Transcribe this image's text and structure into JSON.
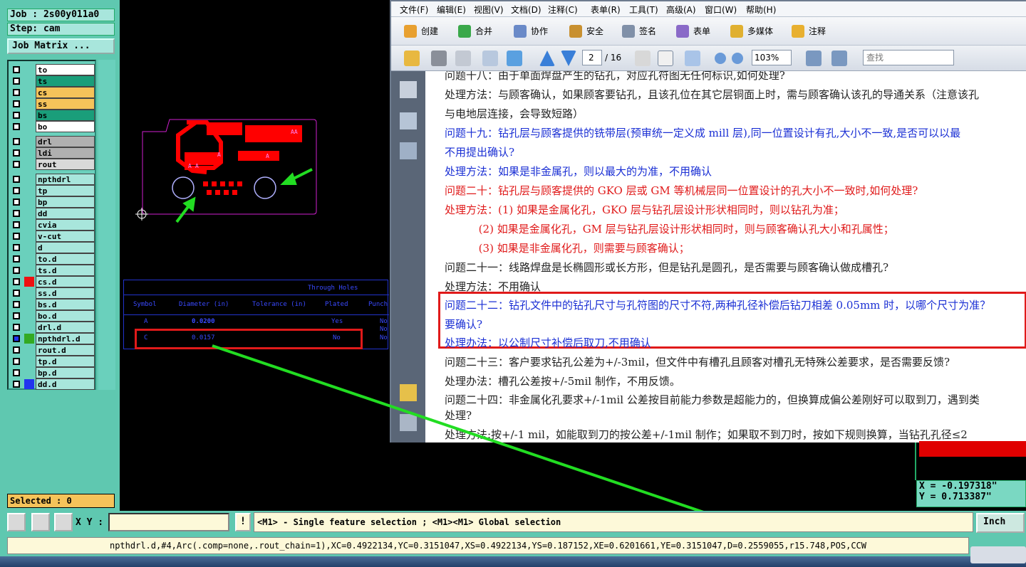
{
  "cam": {
    "job": "Job : 2s00y011a0",
    "step": "Step: cam",
    "job_matrix": "Job Matrix ...",
    "selected": "Selected : 0",
    "layers": [
      {
        "name": "to",
        "color": "#ffffff"
      },
      {
        "name": "ts",
        "color": "#1a9e7a"
      },
      {
        "name": "cs",
        "color": "#f5c35a"
      },
      {
        "name": "ss",
        "color": "#f5c35a"
      },
      {
        "name": "bs",
        "color": "#1a9e7a"
      },
      {
        "name": "bo",
        "color": "#ffffff"
      },
      {
        "name": "drl",
        "color": "#b0b0b0"
      },
      {
        "name": "ldi",
        "color": "#b0b0b0"
      },
      {
        "name": "rout",
        "color": "#d9d9d9"
      },
      {
        "name": "npthdrl",
        "color": "#a8e6dc"
      },
      {
        "name": "tp",
        "color": "#a8e6dc"
      },
      {
        "name": "bp",
        "color": "#a8e6dc"
      },
      {
        "name": "dd",
        "color": "#a8e6dc"
      },
      {
        "name": "cvia",
        "color": "#a8e6dc"
      },
      {
        "name": "v-cut",
        "color": "#a8e6dc"
      },
      {
        "name": "d",
        "color": "#a8e6dc"
      },
      {
        "name": "to.d",
        "color": "#a8e6dc"
      },
      {
        "name": "ts.d",
        "color": "#a8e6dc"
      },
      {
        "name": "cs.d",
        "color": "#a8e6dc",
        "swatch": "#ee1111"
      },
      {
        "name": "ss.d",
        "color": "#a8e6dc"
      },
      {
        "name": "bs.d",
        "color": "#a8e6dc"
      },
      {
        "name": "bo.d",
        "color": "#a8e6dc"
      },
      {
        "name": "drl.d",
        "color": "#a8e6dc"
      },
      {
        "name": "npthdrl.d",
        "color": "#a8e6dc",
        "swatch": "#33aa22",
        "checked": true
      },
      {
        "name": "rout.d",
        "color": "#a8e6dc"
      },
      {
        "name": "tp.d",
        "color": "#a8e6dc"
      },
      {
        "name": "bp.d",
        "color": "#a8e6dc"
      },
      {
        "name": "dd.d",
        "color": "#a8e6dc",
        "swatch": "#2233ee"
      }
    ],
    "pad_labels": [
      "AA",
      "A",
      "A",
      "A",
      "A"
    ],
    "holes_table": {
      "title": "Through Holes",
      "headers": [
        "Symbol",
        "Diameter (in)",
        "Tolerance (in)",
        "Plated",
        "Punch"
      ],
      "rows": [
        {
          "symbol": "A",
          "diameter": "0.0200",
          "plated": "Yes",
          "punch": "No"
        },
        {
          "symbol": "C",
          "diameter": "0.0157",
          "plated": "No",
          "punch": "No"
        }
      ],
      "punch_extra": "No"
    },
    "coords": {
      "x": "X = -0.197318\"",
      "y": "Y =  0.713387\""
    },
    "xy_label": "X Y :",
    "excl": "!",
    "prompt": "<M1> - Single feature selection ; <M1><M1> Global selection",
    "unit": "Inch",
    "feature": "npthdrl.d,#4,Arc(.comp=none,.rout_chain=1),XC=0.4922134,YC=0.3151047,XS=0.4922134,YS=0.187152,XE=0.6201661,YE=0.3151047,D=0.2559055,r15.748,POS,CCW"
  },
  "acrobat": {
    "menu": [
      "文件(F)",
      "编辑(E)",
      "视图(V)",
      "文档(D)",
      "注释(C)",
      "表单(R)",
      "工具(T)",
      "高级(A)",
      "窗口(W)",
      "帮助(H)"
    ],
    "toolbar": [
      {
        "label": "创建",
        "icon": "create-icon"
      },
      {
        "label": "合并",
        "icon": "merge-icon"
      },
      {
        "label": "协作",
        "icon": "collaborate-icon"
      },
      {
        "label": "安全",
        "icon": "lock-icon"
      },
      {
        "label": "签名",
        "icon": "pen-icon"
      },
      {
        "label": "表单",
        "icon": "form-icon"
      },
      {
        "label": "多媒体",
        "icon": "multimedia-icon"
      },
      {
        "label": "注释",
        "icon": "comment-icon"
      }
    ],
    "page_current": "2",
    "page_total": "/ 16",
    "zoom": "103%",
    "find_placeholder": "查找",
    "lines": [
      {
        "text": "问题十八：由于单面焊盘产生的钻孔，对应孔符图无任何标识,如何处理?",
        "color": "black"
      },
      {
        "text": "处理方法：与顾客确认，如果顾客要钻孔，且该孔位在其它层铜面上时，需与顾客确认该孔的导通关系（注意该孔",
        "color": "black"
      },
      {
        "text": "与电地层连接，会导致短路）",
        "color": "black"
      },
      {
        "text": "问题十九：钻孔层与顾客提供的铣带层(预审统一定义成 mill 层),同一位置设计有孔,大小不一致,是否可以以最",
        "color": "blue"
      },
      {
        "text": "不用提出确认?",
        "color": "blue"
      },
      {
        "text": "处理方法：如果是非金属孔，则以最大的为准，不用确认",
        "color": "blue"
      },
      {
        "text": "问题二十：钻孔层与顾客提供的 GKO 层或 GM 等机械层同一位置设计的孔大小不一致时,如何处理?",
        "color": "red"
      },
      {
        "text": "处理方法：(1) 如果是金属化孔，GKO 层与钻孔层设计形状相同时，则以钻孔为准；",
        "color": "red"
      },
      {
        "text": "          (2) 如果是金属化孔，GM 层与钻孔层设计形状相同时，则与顾客确认孔大小和孔属性；",
        "color": "red"
      },
      {
        "text": "          (3) 如果是非金属化孔，则需要与顾客确认；",
        "color": "red"
      },
      {
        "text": "问题二十一：线路焊盘是长椭圆形或长方形，但是钻孔是圆孔，是否需要与顾客确认做成槽孔?",
        "color": "black"
      },
      {
        "text": "处理方法：不用确认",
        "color": "black"
      },
      {
        "text": "问题二十二：钻孔文件中的钻孔尺寸与孔符图的尺寸不符,两种孔径补偿后钻刀相差 0.05mm 时，以哪个尺寸为准？",
        "color": "blue"
      },
      {
        "text": "要确认?",
        "color": "blue"
      },
      {
        "text": "处理办法：以公制尺寸补偿后取刀,不用确认",
        "color": "blue"
      },
      {
        "text": "问题二十三：客户要求钻孔公差为+/-3mil，但文件中有槽孔且顾客对槽孔无特殊公差要求，是否需要反馈?",
        "color": "black"
      },
      {
        "text": "处理办法：槽孔公差按+/-5mil 制作，不用反馈。",
        "color": "black"
      },
      {
        "text": "问题二十四：非金属化孔要求+/-1mil 公差按目前能力参数是超能力的，但换算成偏公差刚好可以取到刀，遇到类",
        "color": "black"
      },
      {
        "text": "处理?",
        "color": "black"
      },
      {
        "text": "处理方法:按+/-1 mil，如能取到刀的按公差+/-1mil 制作；如果取不到刀时，按如下规则换算，当钻孔孔径≤2",
        "color": "black"
      }
    ]
  },
  "colors": {
    "accent": "#5fc8b0",
    "highlight": "#e01a1a",
    "arrow": "#22dd22"
  }
}
